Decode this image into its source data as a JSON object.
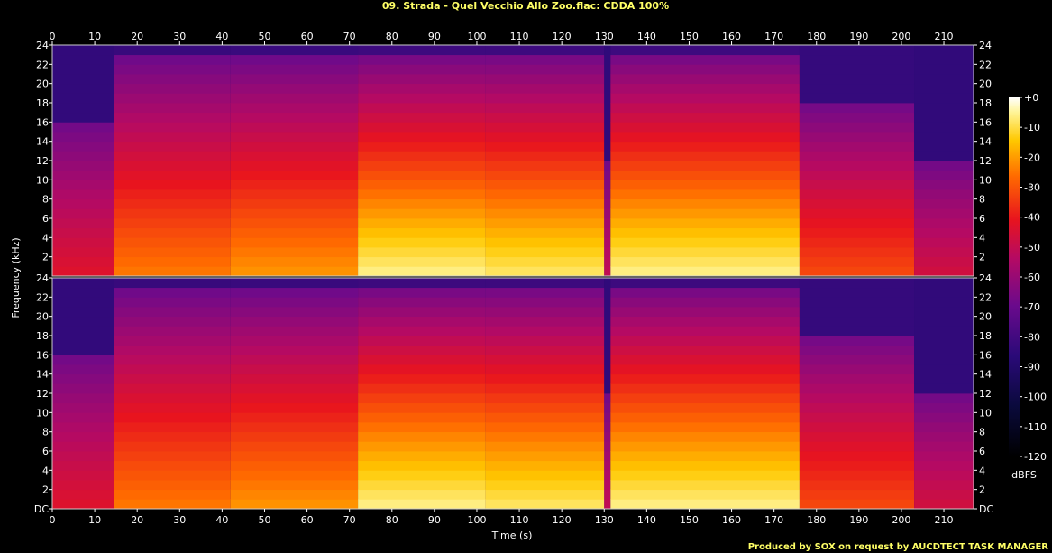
{
  "chart_data": {
    "type": "heatmap",
    "title": "09. Strada - Quel Vecchio Allo Zoo.flac: CDDA 100%",
    "xlabel": "Time (s)",
    "ylabel": "Frequency (kHz)",
    "xlim": [
      0,
      217
    ],
    "ylim": [
      0,
      24
    ],
    "x_ticks": [
      0,
      10,
      20,
      30,
      40,
      50,
      60,
      70,
      80,
      90,
      100,
      110,
      120,
      130,
      140,
      150,
      160,
      170,
      180,
      190,
      200,
      210
    ],
    "y_ticks": [
      "DC",
      "2",
      "4",
      "6",
      "8",
      "10",
      "12",
      "14",
      "16",
      "18",
      "20",
      "22",
      "24"
    ],
    "channels": 2,
    "colorbar": {
      "label": "dBFS",
      "ticks": [
        "+0",
        "-10",
        "-20",
        "-30",
        "-40",
        "-50",
        "-60",
        "-70",
        "-80",
        "-90",
        "-100",
        "-110",
        "-120"
      ],
      "range": [
        -120,
        0
      ]
    },
    "segments": [
      {
        "start": 0,
        "end": 14.5,
        "level": 0.35,
        "cutoff": 16
      },
      {
        "start": 14.5,
        "end": 42,
        "level": 0.6,
        "cutoff": 22.5
      },
      {
        "start": 42,
        "end": 72,
        "level": 0.65,
        "cutoff": 22.5
      },
      {
        "start": 72,
        "end": 102,
        "level": 0.85,
        "cutoff": 23
      },
      {
        "start": 102,
        "end": 130,
        "level": 0.82,
        "cutoff": 23
      },
      {
        "start": 130,
        "end": 131.5,
        "level": 0.25,
        "cutoff": 12
      },
      {
        "start": 131.5,
        "end": 176,
        "level": 0.85,
        "cutoff": 23
      },
      {
        "start": 176,
        "end": 203,
        "level": 0.5,
        "cutoff": 18
      },
      {
        "start": 203,
        "end": 217,
        "level": 0.3,
        "cutoff": 12
      }
    ],
    "footer": "Produced by SOX on request by AUCDTECT TASK MANAGER"
  }
}
